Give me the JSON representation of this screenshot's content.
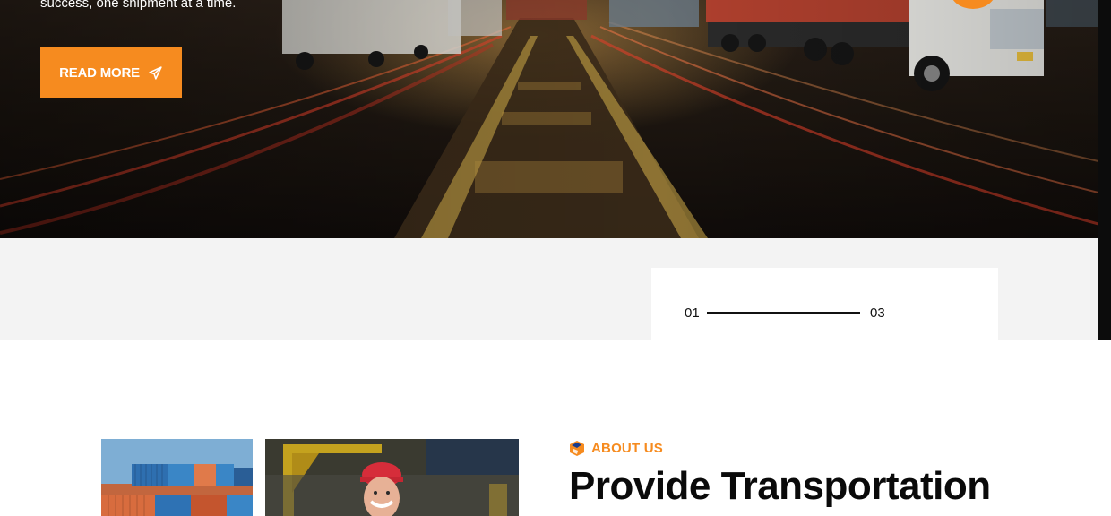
{
  "hero": {
    "tagline": "success, one shipment at a time.",
    "read_more_label": "READ MORE",
    "icons": {
      "read_more": "paper-plane-icon"
    }
  },
  "slider": {
    "current": "01",
    "total": "03"
  },
  "about": {
    "tag_label": "ABOUT US",
    "title": "Provide Transportation",
    "icons": {
      "tag": "logo-mark-icon"
    }
  },
  "colors": {
    "accent": "#f68b1f",
    "heading": "#0a0a0a",
    "strip_bg": "#f3f3f3"
  }
}
